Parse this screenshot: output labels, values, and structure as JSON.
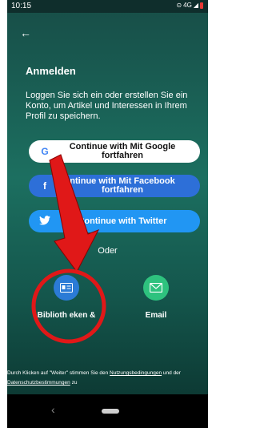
{
  "status_bar": {
    "time": "10:15",
    "network": "4G"
  },
  "header": {
    "title": "Anmelden",
    "description": "Loggen Sie sich ein oder erstellen Sie ein Konto, um Artikel und Interessen in Ihrem Profil zu speichern."
  },
  "social_buttons": [
    {
      "label": "Continue with Mit Google fortfahren",
      "icon": "google-icon"
    },
    {
      "label": "ntinue with Mit Facebook fortfahren",
      "icon": "facebook-icon"
    },
    {
      "label": "Continue with Twitter",
      "icon": "twitter-icon"
    }
  ],
  "divider_text": "Oder",
  "options": [
    {
      "label": "Biblioth eken &",
      "icon": "library-card-icon"
    },
    {
      "label": "Email",
      "icon": "email-icon"
    }
  ],
  "footer": {
    "prefix": "Durch Klicken auf \"Weiter\" stimmen Sie den ",
    "terms_link": "Nutzungsbedingungen",
    "middle": " und der ",
    "privacy_link": "Datenschutzbestimmungen",
    "suffix": " zu"
  },
  "colors": {
    "annotation_red": "#e01818",
    "facebook_blue": "#2d6fd8",
    "twitter_blue": "#2196f3",
    "email_green": "#2ec27e",
    "library_blue": "#2b7bd6"
  }
}
